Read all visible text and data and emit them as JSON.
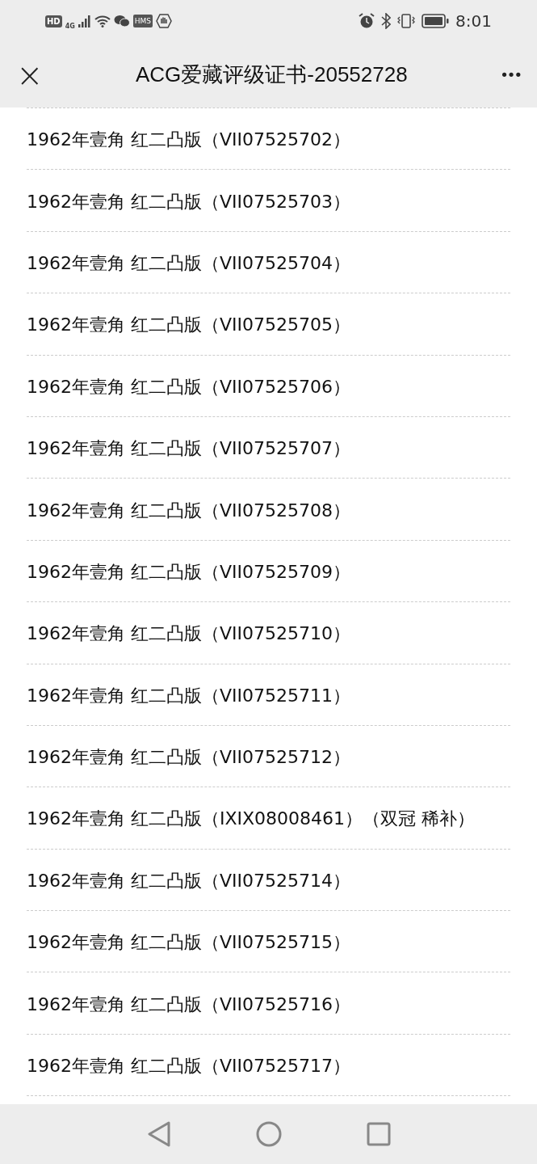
{
  "status_bar": {
    "hd_badge": "HD",
    "network": "4G",
    "hms_badge": "HMS",
    "time": "8:01"
  },
  "header": {
    "close": "×",
    "title": "ACG爱藏评级证书-20552728",
    "more": "•••"
  },
  "items": [
    {
      "text": "1962年壹角 红二凸版（VII07525702）"
    },
    {
      "text": "1962年壹角 红二凸版（VII07525703）"
    },
    {
      "text": "1962年壹角 红二凸版（VII07525704）"
    },
    {
      "text": "1962年壹角 红二凸版（VII07525705）"
    },
    {
      "text": "1962年壹角 红二凸版（VII07525706）"
    },
    {
      "text": "1962年壹角 红二凸版（VII07525707）"
    },
    {
      "text": "1962年壹角 红二凸版（VII07525708）"
    },
    {
      "text": "1962年壹角 红二凸版（VII07525709）"
    },
    {
      "text": "1962年壹角 红二凸版（VII07525710）"
    },
    {
      "text": "1962年壹角 红二凸版（VII07525711）"
    },
    {
      "text": "1962年壹角 红二凸版（VII07525712）"
    },
    {
      "text": "1962年壹角 红二凸版（IXIX08008461）（双冠 稀补）"
    },
    {
      "text": "1962年壹角 红二凸版（VII07525714）"
    },
    {
      "text": "1962年壹角 红二凸版（VII07525715）"
    },
    {
      "text": "1962年壹角 红二凸版（VII07525716）"
    },
    {
      "text": "1962年壹角 红二凸版（VII07525717）"
    }
  ]
}
